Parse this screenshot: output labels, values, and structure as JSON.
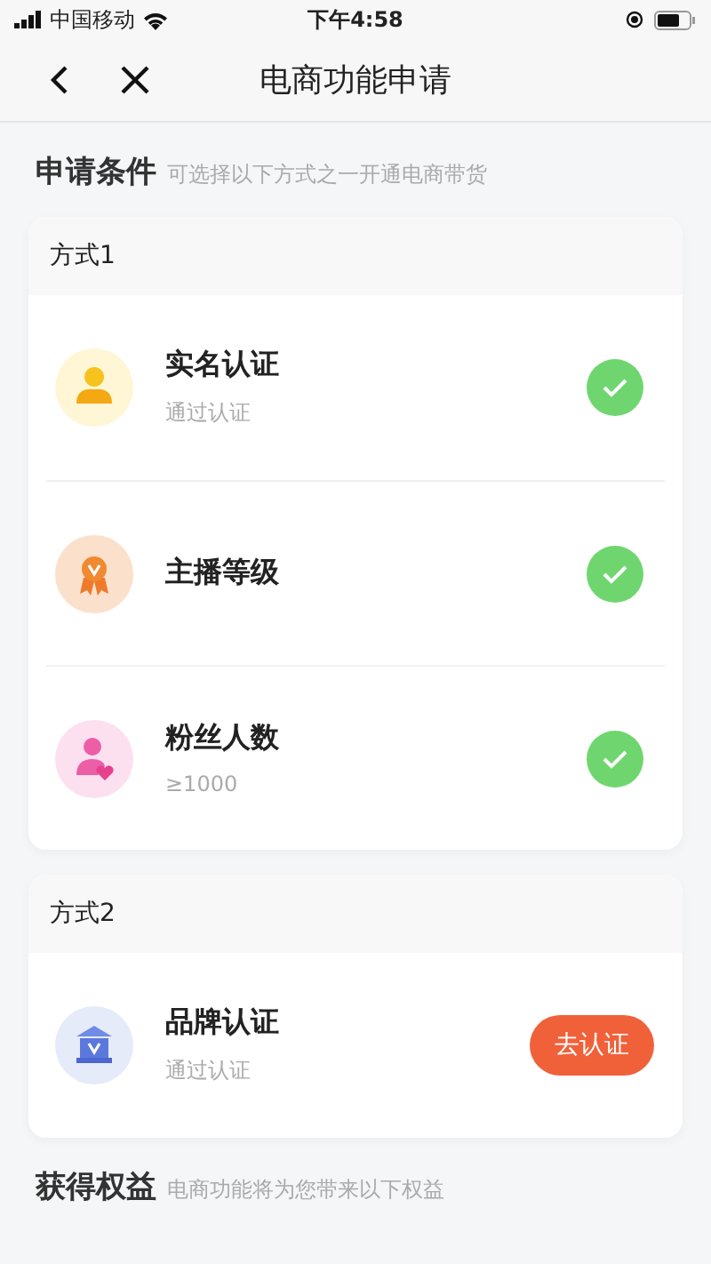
{
  "status_bar": {
    "carrier": "中国移动",
    "time": "下午4:58"
  },
  "nav": {
    "title": "电商功能申请"
  },
  "conditions": {
    "title": "申请条件",
    "hint": "可选择以下方式之一开通电商带货"
  },
  "methods": [
    {
      "title": "方式1",
      "items": [
        {
          "title": "实名认证",
          "subtitle": "通过认证",
          "kind": "check",
          "done": true
        },
        {
          "title": "主播等级",
          "kind": "check",
          "done": true
        },
        {
          "title": "粉丝人数",
          "subtitle": "≥1000",
          "kind": "check",
          "done": true
        }
      ]
    },
    {
      "title": "方式2",
      "items": [
        {
          "title": "品牌认证",
          "subtitle": "通过认证",
          "kind": "button",
          "action": "去认证"
        }
      ]
    }
  ],
  "benefits": {
    "title": "获得权益",
    "hint": "电商功能将为您带来以下权益"
  }
}
